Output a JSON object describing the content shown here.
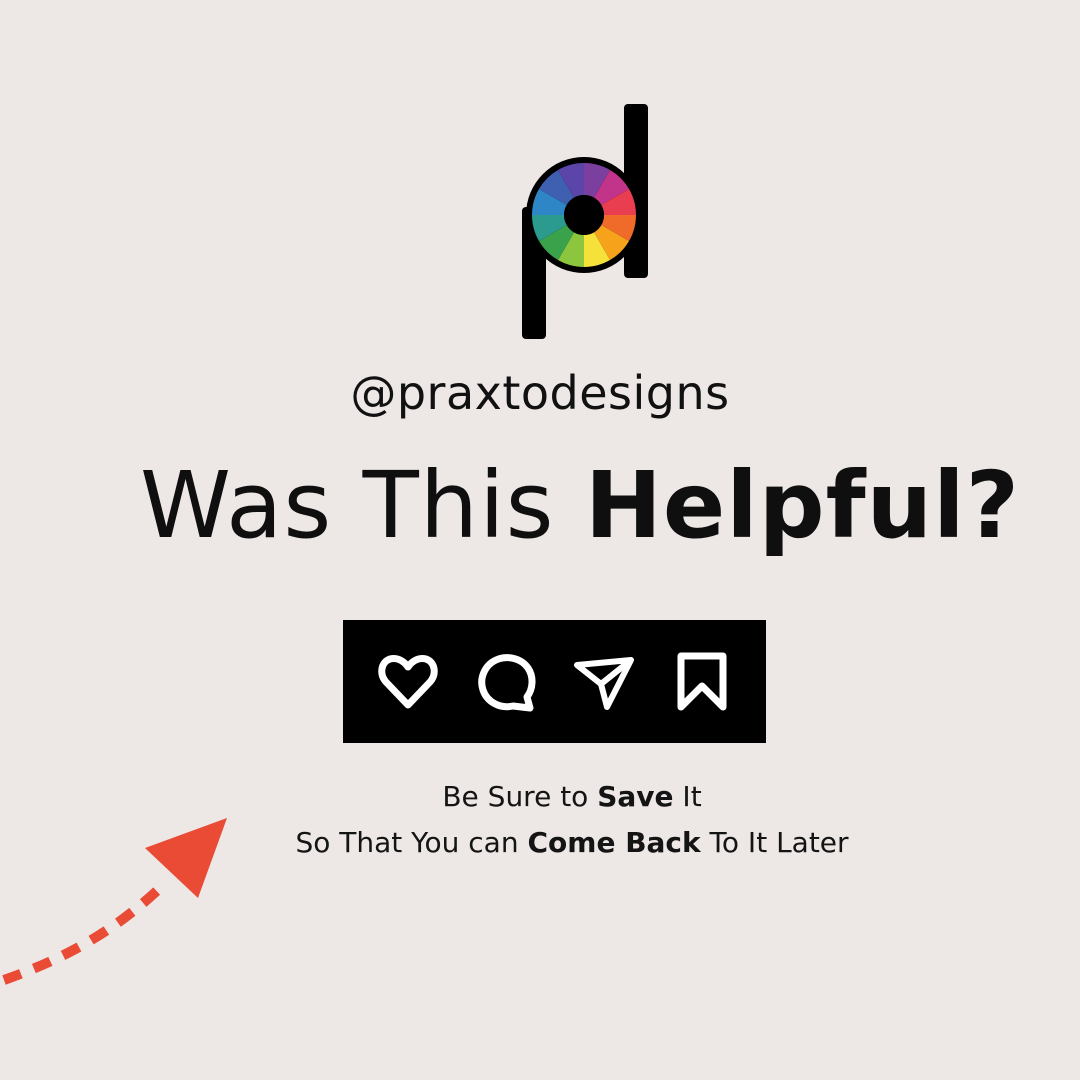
{
  "brand": {
    "logo_icon": "pd-color-wheel-logo",
    "handle": "@praxtodesigns"
  },
  "headline": {
    "regular": "Was This ",
    "bold": "Helpful?"
  },
  "actions": [
    {
      "icon": "heart-icon",
      "label": "Like"
    },
    {
      "icon": "comment-icon",
      "label": "Comment"
    },
    {
      "icon": "send-icon",
      "label": "Share"
    },
    {
      "icon": "bookmark-icon",
      "label": "Save"
    }
  ],
  "cta": {
    "line1": {
      "pre": "Be Sure to ",
      "bold": "Save",
      "post": " It"
    },
    "line2": {
      "pre": "So That You can ",
      "bold": "Come Back",
      "post": " To It Later"
    }
  },
  "colors": {
    "background": "#ede7e6",
    "text": "#111111",
    "action_bar": "#000000",
    "arrow": "#e94b35"
  }
}
